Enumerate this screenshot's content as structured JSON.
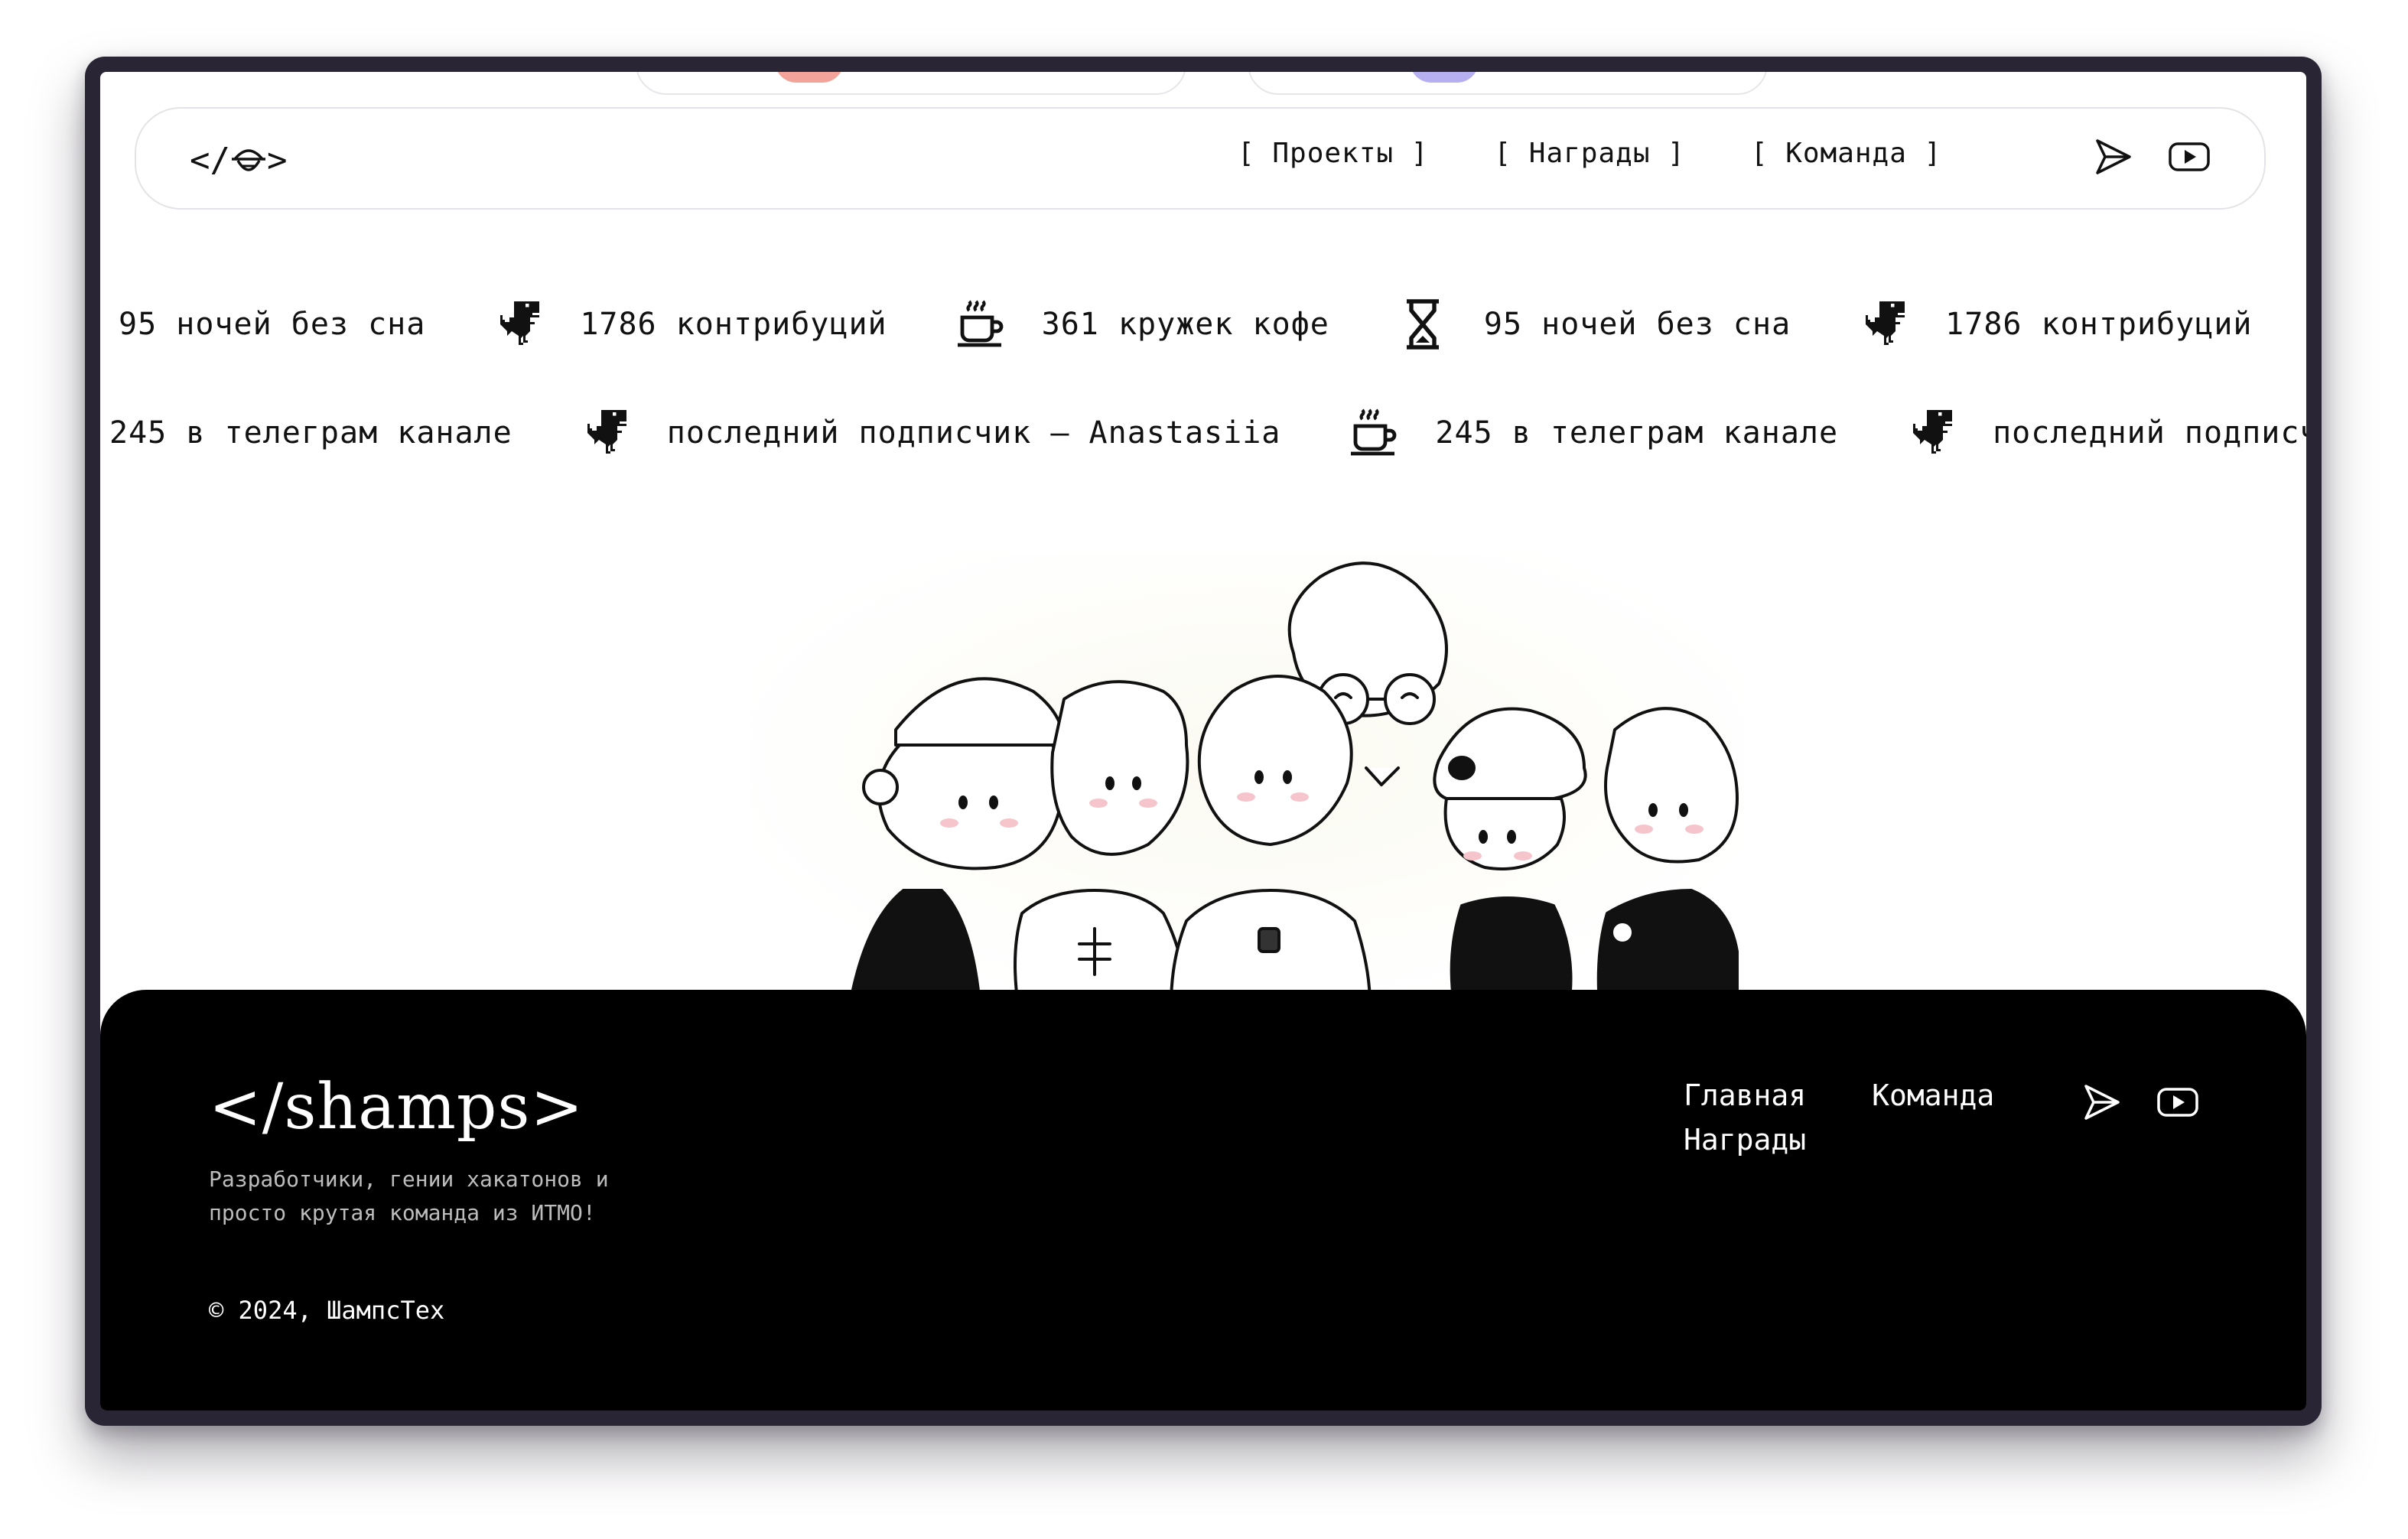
{
  "nav": {
    "logo": "</😶>",
    "links": [
      "[ Проекты ]",
      "[ Награды ]",
      "[ Команда ]"
    ],
    "icons": [
      "send-icon",
      "youtube-icon"
    ]
  },
  "ticker_row1": [
    {
      "icon": "hourglass-icon",
      "text": "95 ночей без сна"
    },
    {
      "icon": "dino-icon",
      "text": "1786 контрибуций"
    },
    {
      "icon": "coffee-icon",
      "text": "361 кружек кофе"
    },
    {
      "icon": "hourglass-icon",
      "text": "95 ночей без сна"
    },
    {
      "icon": "dino-icon",
      "text": "1786 контрибуций"
    },
    {
      "icon": "coffee-icon",
      "text": "361 кружек кофе"
    }
  ],
  "ticker_row2": [
    {
      "icon": "coffee-icon",
      "text": "245 в телеграм канале"
    },
    {
      "icon": "dino-icon",
      "text": "последний подписчик — Anastasiia"
    },
    {
      "icon": "coffee-icon",
      "text": "245 в телеграм канале"
    },
    {
      "icon": "dino-icon",
      "text": "последний подписчик — Anastasiia"
    }
  ],
  "footer": {
    "logo": "</shamps>",
    "description": "Разработчики, гении хакатонов и просто крутая команда из ИТМО!",
    "copyright": "© 2024, ШампсТех",
    "links": [
      "Главная",
      "Команда",
      "Награды"
    ],
    "icons": [
      "send-icon",
      "youtube-icon"
    ]
  }
}
